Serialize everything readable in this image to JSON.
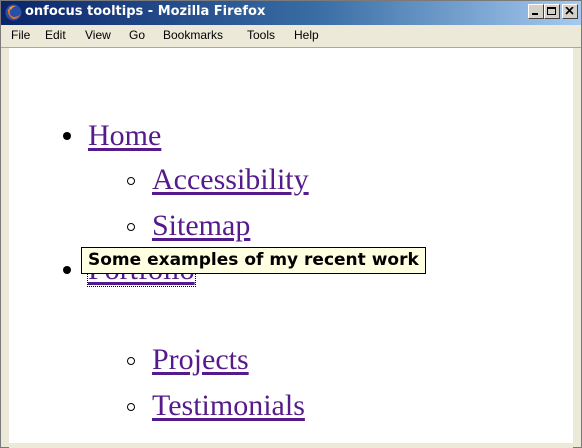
{
  "window": {
    "title": "onfocus tooltips - Mozilla Firefox"
  },
  "menubar": {
    "items": [
      {
        "label": "File"
      },
      {
        "label": "Edit"
      },
      {
        "label": "View"
      },
      {
        "label": "Go"
      },
      {
        "label": "Bookmarks"
      },
      {
        "label": "Tools"
      },
      {
        "label": "Help"
      }
    ]
  },
  "nav": {
    "items": [
      {
        "label": "Home",
        "children": [
          {
            "label": "Accessibility"
          },
          {
            "label": "Sitemap"
          }
        ]
      },
      {
        "label": "Portfolio",
        "focused": true,
        "children": [
          {
            "label": "Projects"
          },
          {
            "label": "Testimonials"
          }
        ]
      }
    ]
  },
  "tooltip": {
    "text": "Some examples of my recent work"
  },
  "colors": {
    "link_visited": "#551a8b",
    "tooltip_bg": "#ffffe1",
    "titlebar_start": "#0a246a",
    "titlebar_end": "#a6caf0"
  }
}
